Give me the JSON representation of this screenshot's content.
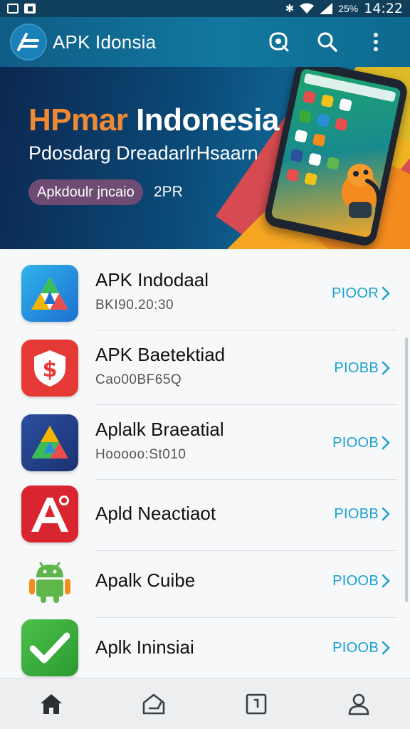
{
  "status_bar": {
    "battery": "25%",
    "time": "14:22",
    "icons": [
      "notification-icon",
      "gallery-icon",
      "bluetooth-icon",
      "wifi-icon",
      "signal-icon",
      "battery-icon"
    ]
  },
  "app_bar": {
    "title": "APK Idonsia",
    "icons": [
      "scan-icon",
      "search-icon",
      "more-vertical-icon"
    ]
  },
  "banner": {
    "title_accent": "HPmar",
    "title_rest": "Indonesia",
    "subtitle": "Pdosdarg DreadarlrHsaarn",
    "chip": "Apkdoulr jncaio",
    "tag": "2PR",
    "colors": {
      "navy": "#0c2750",
      "blue": "#1587b5",
      "orange": "#ef8a33"
    }
  },
  "apps": [
    {
      "name": "APK Indodaal",
      "sub": "BKI90.20:30",
      "action": "PIOOR",
      "icon": "play-triangle-icon",
      "color": "#2a8fd8"
    },
    {
      "name": "APK Baetektiad",
      "sub": "Cao00BF65Q",
      "action": "PIOBB",
      "icon": "shield-dollar-icon",
      "color": "#e53935"
    },
    {
      "name": "Aplalk Braeatial",
      "sub": "Hooooo:St010",
      "action": "PIOOB",
      "icon": "star-icon",
      "color": "#2c4f9e"
    },
    {
      "name": "Apld Neactiaot",
      "sub": "",
      "action": "PIOBB",
      "icon": "letter-a-icon",
      "color": "#d9252f"
    },
    {
      "name": "Apalk Cuibe",
      "sub": "",
      "action": "PIOOB",
      "icon": "android-icon",
      "color": "#5fb64b"
    },
    {
      "name": "Aplk Ininsiai",
      "sub": "",
      "action": "PIOOB",
      "icon": "checkmark-icon",
      "color": "#3aa935"
    }
  ],
  "bottom_nav": [
    "home-icon",
    "store-icon",
    "download-icon",
    "profile-icon"
  ],
  "accent_color": "#1aa0d0"
}
